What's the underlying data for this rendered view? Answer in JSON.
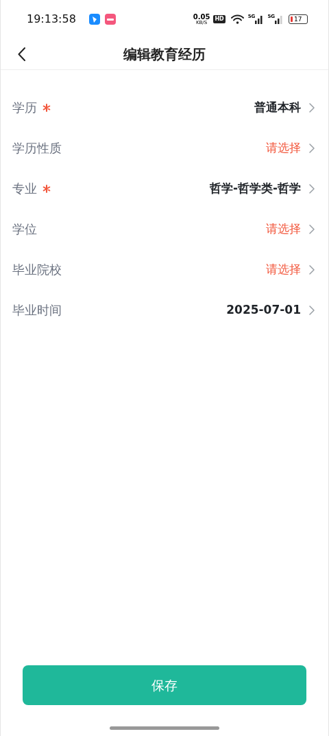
{
  "status_bar": {
    "time": "19:13:58",
    "net_speed": "0.05",
    "net_unit": "KB/S",
    "hd": "HD",
    "sim1": "5G",
    "sim2": "5G",
    "battery": "17"
  },
  "header": {
    "title": "编辑教育经历"
  },
  "fields": [
    {
      "label": "学历",
      "required": true,
      "value": "普通本科"
    },
    {
      "label": "学历性质",
      "required": false,
      "placeholder": "请选择"
    },
    {
      "label": "专业",
      "required": true,
      "value": "哲学-哲学类-哲学"
    },
    {
      "label": "学位",
      "required": false,
      "placeholder": "请选择"
    },
    {
      "label": "毕业院校",
      "required": false,
      "placeholder": "请选择"
    },
    {
      "label": "毕业时间",
      "required": false,
      "value": "2025-07-01"
    }
  ],
  "save_button": {
    "label": "保存"
  }
}
